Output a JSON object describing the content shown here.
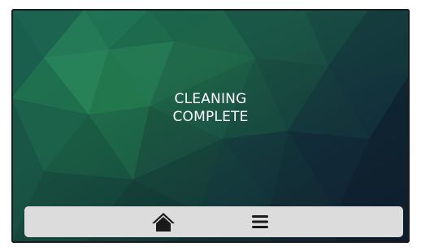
{
  "screen": {
    "message_line1": "CLEANING",
    "message_line2": "COMPLETE"
  },
  "navbar": {
    "home_icon": "home-icon",
    "menu_icon": "hamburger-menu-icon"
  },
  "colors": {
    "navbar_bg": "#dcdcdc",
    "icon": "#1a1a1a",
    "text": "#ffffff",
    "background_primary": "#1f6b4a",
    "background_dark": "#0d1a2a"
  }
}
